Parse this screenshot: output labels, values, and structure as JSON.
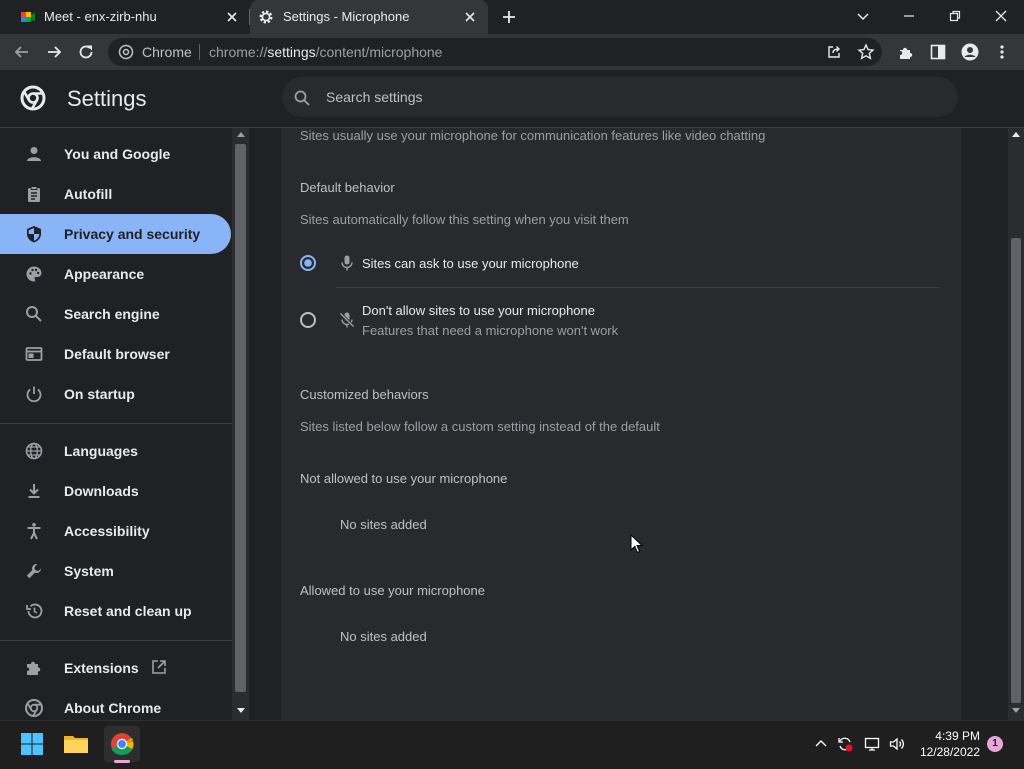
{
  "tabs": [
    {
      "title": "Meet - enx-zirb-nhu",
      "icon": "google-meet-icon",
      "active": false
    },
    {
      "title": "Settings - Microphone",
      "icon": "gear-icon",
      "active": true
    }
  ],
  "omnibox": {
    "site_label": "Chrome",
    "url_prefix": "chrome://",
    "url_host": "settings",
    "url_path": "/content/microphone"
  },
  "header": {
    "title": "Settings",
    "search_placeholder": "Search settings"
  },
  "sidebar": {
    "items": [
      {
        "label": "You and Google",
        "icon": "person-icon"
      },
      {
        "label": "Autofill",
        "icon": "clipboard-icon"
      },
      {
        "label": "Privacy and security",
        "icon": "shield-icon",
        "active": true
      },
      {
        "label": "Appearance",
        "icon": "palette-icon"
      },
      {
        "label": "Search engine",
        "icon": "search-icon"
      },
      {
        "label": "Default browser",
        "icon": "browser-icon"
      },
      {
        "label": "On startup",
        "icon": "power-icon"
      },
      {
        "label": "Languages",
        "icon": "globe-icon"
      },
      {
        "label": "Downloads",
        "icon": "download-icon"
      },
      {
        "label": "Accessibility",
        "icon": "accessibility-icon"
      },
      {
        "label": "System",
        "icon": "wrench-icon"
      },
      {
        "label": "Reset and clean up",
        "icon": "history-icon"
      },
      {
        "label": "Extensions",
        "icon": "puzzle-icon"
      },
      {
        "label": "About Chrome",
        "icon": "chrome-icon"
      }
    ]
  },
  "content": {
    "intro": "Sites usually use your microphone for communication features like video chatting",
    "default_heading": "Default behavior",
    "default_sub": "Sites automatically follow this setting when you visit them",
    "options": [
      {
        "label": "Sites can ask to use your microphone",
        "sub": "",
        "selected": true,
        "icon": "mic-icon"
      },
      {
        "label": "Don't allow sites to use your microphone",
        "sub": "Features that need a microphone won't work",
        "selected": false,
        "icon": "mic-off-icon"
      }
    ],
    "custom_heading": "Customized behaviors",
    "custom_sub": "Sites listed below follow a custom setting instead of the default",
    "not_allowed_heading": "Not allowed to use your microphone",
    "not_allowed_empty": "No sites added",
    "allowed_heading": "Allowed to use your microphone",
    "allowed_empty": "No sites added"
  },
  "taskbar": {
    "time": "4:39 PM",
    "date": "12/28/2022",
    "notification_count": "1"
  },
  "colors": {
    "accent": "#8ab4f8",
    "background": "#202124",
    "card": "#292a2d"
  }
}
